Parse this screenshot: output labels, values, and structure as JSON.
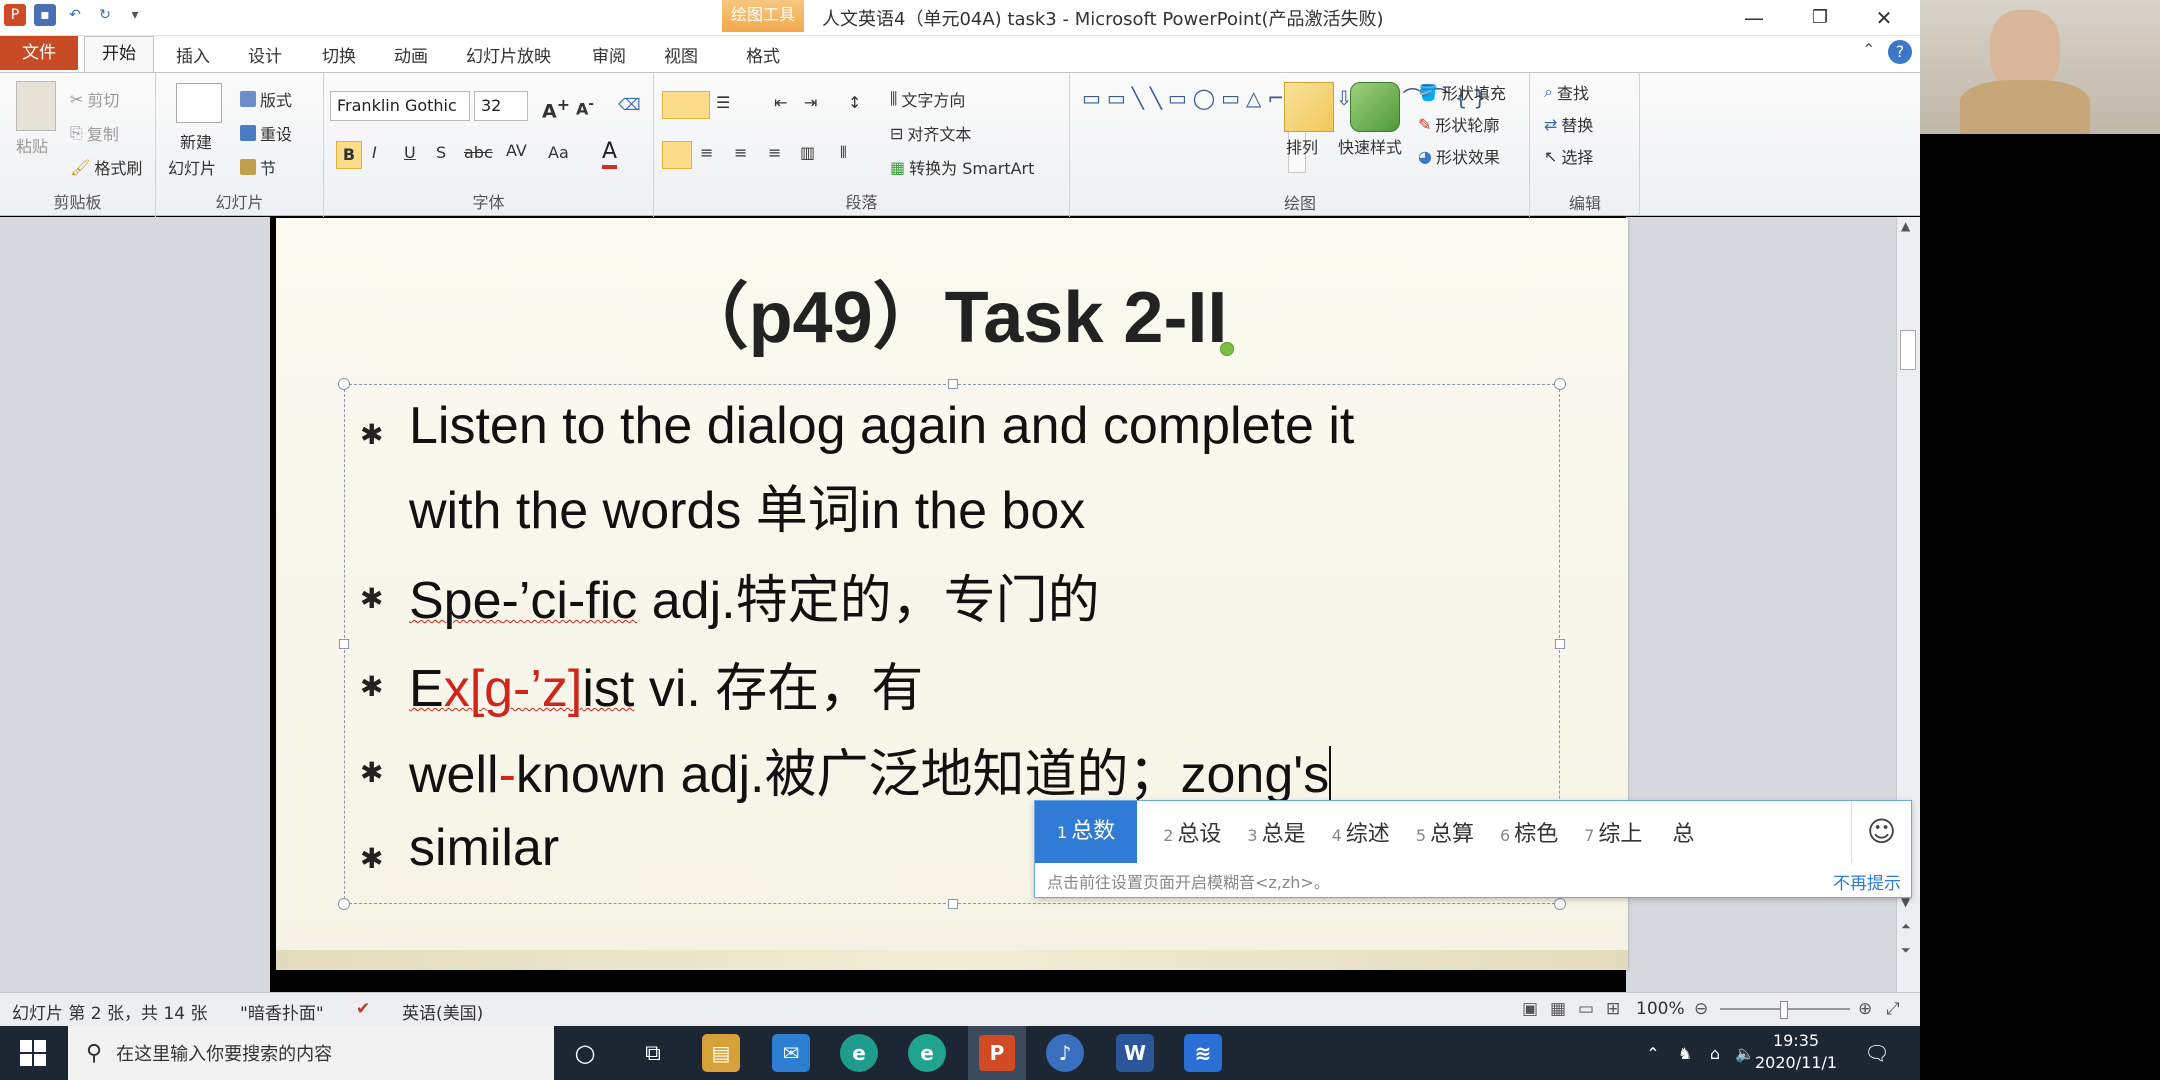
{
  "titlebar": {
    "context_tab": "绘图工具",
    "document_title": "人文英语4（单元04A) task3 - Microsoft PowerPoint(产品激活失败)"
  },
  "tabs": {
    "file": "文件",
    "home": "开始",
    "items": [
      "插入",
      "设计",
      "切换",
      "动画",
      "幻灯片放映",
      "审阅",
      "视图",
      "格式"
    ]
  },
  "ribbon": {
    "clipboard": {
      "paste": "粘贴",
      "cut": "剪切",
      "copy": "复制",
      "format_painter": "格式刷",
      "label": "剪贴板"
    },
    "slides": {
      "new_slide": "新建",
      "new_slide2": "幻灯片",
      "layout": "版式",
      "reset": "重设",
      "section": "节",
      "label": "幻灯片"
    },
    "font": {
      "family": "Franklin Gothic",
      "size": "32",
      "label": "字体"
    },
    "paragraph": {
      "text_direction": "文字方向",
      "align_text": "对齐文本",
      "smartart": "转换为 SmartArt",
      "label": "段落"
    },
    "drawing": {
      "arrange": "排列",
      "quick_styles": "快速样式",
      "fill": "形状填充",
      "outline": "形状轮廓",
      "effects": "形状效果",
      "label": "绘图"
    },
    "editing": {
      "find": "查找",
      "replace": "替换",
      "select": "选择",
      "label": "编辑"
    }
  },
  "slide": {
    "title": "（p49）Task 2-II",
    "lines": {
      "l1a": "Listen to the dialog again and complete it",
      "l1b": "with the words 单词in the box",
      "l2_a": "Spe",
      "l2_b": "-’ci-fic",
      "l2_c": "  adj.特定的，专门的",
      "l3_a": "E",
      "l3_b": "x[g-’z]",
      "l3_c": "ist",
      "l3_d": "   vi. 存在，有",
      "l4_a": "well",
      "l4_b": "-",
      "l4_c": "known adj.被广泛地知道的；",
      "l4_d": "zong's",
      "l5": "similar"
    }
  },
  "ime": {
    "candidates": [
      {
        "n": "1",
        "t": "总数"
      },
      {
        "n": "2",
        "t": "总设"
      },
      {
        "n": "3",
        "t": "总是"
      },
      {
        "n": "4",
        "t": "综述"
      },
      {
        "n": "5",
        "t": "总算"
      },
      {
        "n": "6",
        "t": "棕色"
      },
      {
        "n": "7",
        "t": "综上"
      },
      {
        "n": "",
        "t": "总"
      }
    ],
    "hint": "点击前往设置页面开启模糊音<z,zh>。",
    "dismiss": "不再提示"
  },
  "status": {
    "slide_info": "幻灯片 第 2 张，共 14 张",
    "theme": "\"暗香扑面\"",
    "language": "英语(美国)",
    "zoom": "100%"
  },
  "taskbar": {
    "search_placeholder": "在这里输入你要搜索的内容",
    "time": "19:35",
    "date": "2020/11/1"
  }
}
